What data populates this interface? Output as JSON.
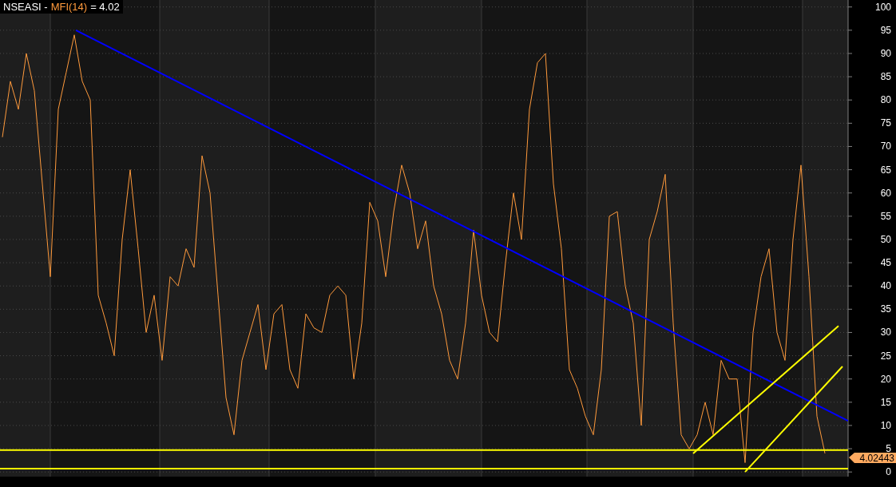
{
  "title": {
    "symbol": "NSEASI -",
    "value_text": "= 4.02"
  },
  "chart_data": {
    "type": "line",
    "grid": true,
    "ylim": [
      -1,
      101.5
    ],
    "yticks": [
      0,
      5,
      10,
      15,
      20,
      25,
      30,
      35,
      40,
      45,
      50,
      55,
      60,
      65,
      70,
      75,
      80,
      85,
      90,
      95,
      100
    ],
    "series": [
      {
        "name": "MFI(14)",
        "color": "#ff9a3c",
        "values": [
          72,
          84,
          78,
          90,
          82,
          62,
          42,
          78,
          86,
          94,
          84,
          80,
          38,
          32,
          25,
          50,
          65,
          48,
          30,
          38,
          24,
          42,
          40,
          48,
          44,
          68,
          60,
          38,
          16,
          8,
          24,
          30,
          36,
          22,
          34,
          36,
          22,
          18,
          34,
          31,
          30,
          38,
          40,
          38,
          20,
          32,
          58,
          54,
          42,
          56,
          66,
          60,
          48,
          54,
          40,
          34,
          24,
          20,
          32,
          52,
          38,
          30,
          28,
          45,
          60,
          50,
          78,
          88,
          90,
          62,
          48,
          22,
          18,
          12,
          8,
          22,
          55,
          56,
          40,
          32,
          10,
          50,
          56,
          64,
          32,
          8,
          5,
          8,
          15,
          8,
          24,
          20,
          20,
          2,
          30,
          42,
          48,
          30,
          24,
          50,
          66,
          42,
          12,
          4
        ]
      }
    ]
  },
  "last_value_label": "4.02443"
}
